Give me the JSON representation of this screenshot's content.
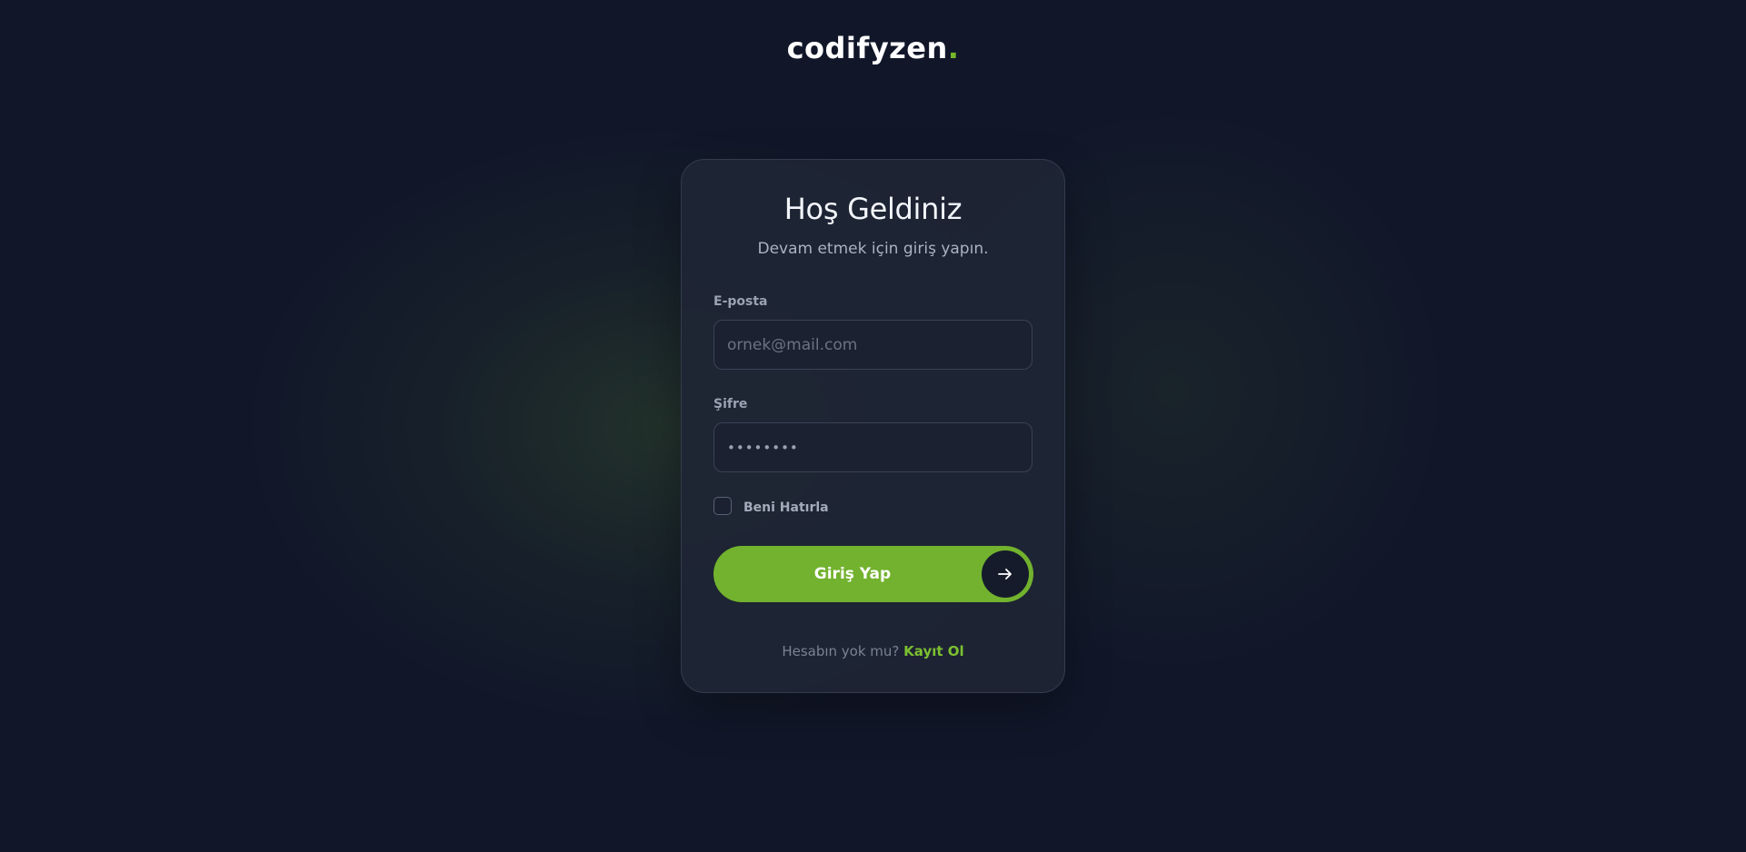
{
  "brand": {
    "name": "codifyzen",
    "dot": "."
  },
  "login": {
    "title": "Hoş Geldiniz",
    "subtitle": "Devam etmek için giriş yapın.",
    "email": {
      "label": "E-posta",
      "placeholder": "ornek@mail.com",
      "value": ""
    },
    "password": {
      "label": "Şifre",
      "placeholder": "••••••••",
      "value": ""
    },
    "remember": {
      "label": "Beni Hatırla",
      "checked": false
    },
    "submit_label": "Giriş Yap",
    "submit_icon": "arrow-right-icon",
    "footer_text": "Hesabın yok mu?",
    "footer_link": "Kayıt Ol"
  },
  "colors": {
    "accent": "#72b22e",
    "background": "#111729",
    "card": "#1e2534"
  }
}
